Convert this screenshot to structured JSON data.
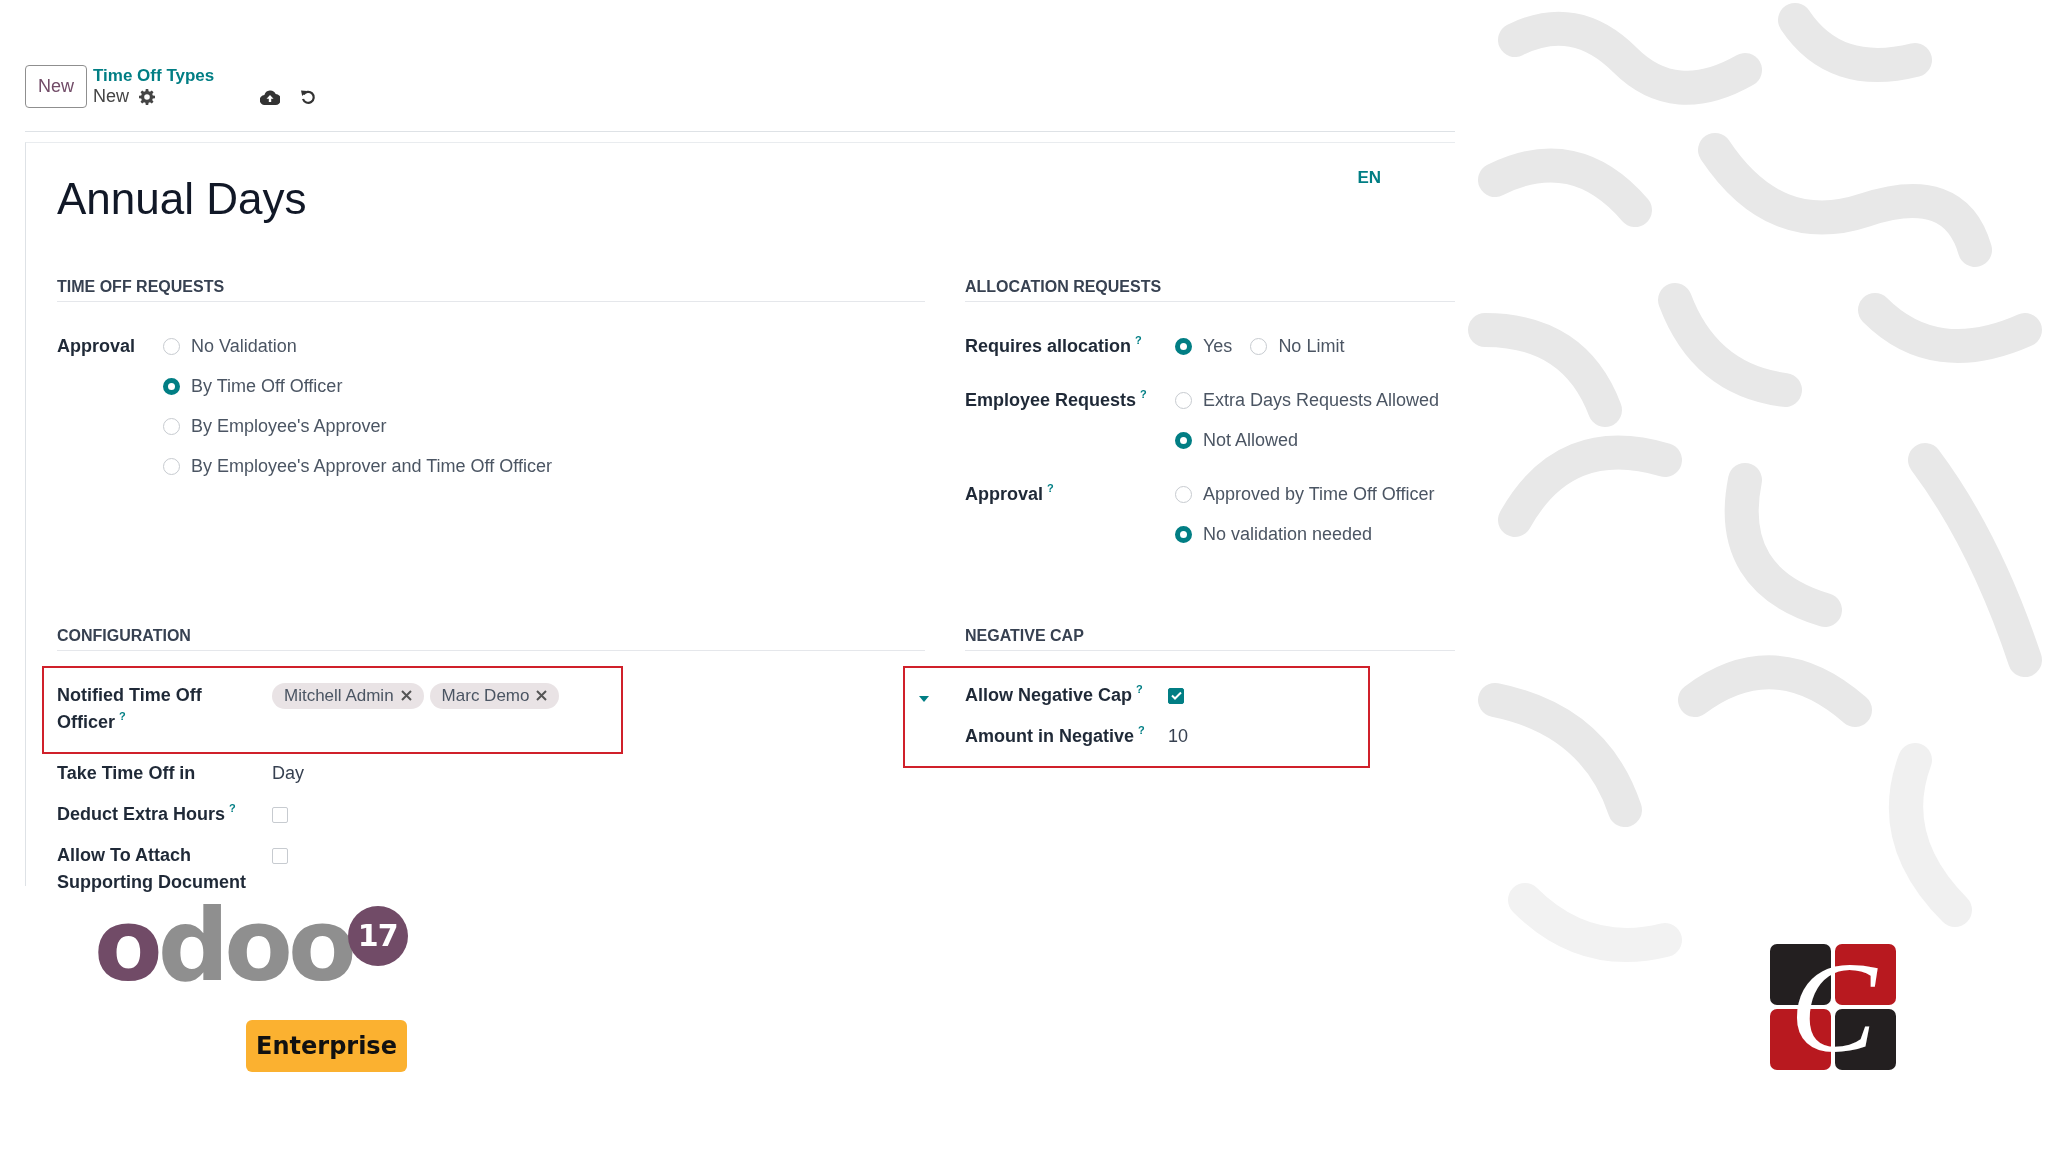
{
  "control_panel": {
    "new_button": "New",
    "breadcrumb": "Time Off Types",
    "record_name": "New"
  },
  "form": {
    "title": "Annual Days",
    "language": "EN",
    "sections": [
      {
        "heading": "TIME OFF REQUESTS",
        "groups": [
          {
            "highlighted": false,
            "fields": [
              {
                "kind": "radio",
                "label": "Approval",
                "options": [
                  {
                    "label": "No Validation",
                    "selected": false
                  },
                  {
                    "label": "By Time Off Officer",
                    "selected": true
                  },
                  {
                    "label": "By Employee's Approver",
                    "selected": false
                  },
                  {
                    "label": "By Employee's Approver and Time Off Officer",
                    "selected": false
                  }
                ]
              }
            ]
          }
        ]
      },
      {
        "heading": "ALLOCATION REQUESTS",
        "groups": [
          {
            "highlighted": false,
            "fields": [
              {
                "kind": "inline_radio",
                "label": "Requires allocation",
                "help": "?",
                "options": [
                  {
                    "label": "Yes",
                    "selected": true
                  },
                  {
                    "label": "No Limit",
                    "selected": false
                  }
                ]
              },
              {
                "kind": "radio",
                "label": "Employee Requests",
                "help": "?",
                "options": [
                  {
                    "label": "Extra Days Requests Allowed",
                    "selected": false
                  },
                  {
                    "label": "Not Allowed",
                    "selected": true
                  }
                ]
              },
              {
                "kind": "radio",
                "label": "Approval",
                "help": "?",
                "options": [
                  {
                    "label": "Approved by Time Off Officer",
                    "selected": false
                  },
                  {
                    "label": "No validation needed",
                    "selected": true
                  }
                ]
              }
            ]
          }
        ]
      },
      {
        "heading": "CONFIGURATION",
        "groups": [
          {
            "highlighted": true,
            "fields": [
              {
                "kind": "tags",
                "label": "Notified Time Off Officer",
                "help": "?",
                "tags": [
                  "Mitchell Admin",
                  "Marc Demo"
                ]
              }
            ]
          },
          {
            "highlighted": false,
            "fields": [
              {
                "kind": "text",
                "label": "Take Time Off in",
                "value": "Day"
              },
              {
                "kind": "checkbox",
                "label": "Deduct Extra Hours",
                "help": "?",
                "checked": false
              },
              {
                "kind": "checkbox",
                "label": "Allow To Attach Supporting Document",
                "checked": false
              }
            ]
          }
        ]
      },
      {
        "heading": "NEGATIVE CAP",
        "groups": [
          {
            "highlighted": true,
            "expanded": true,
            "fields": [
              {
                "kind": "checkbox",
                "label": "Allow Negative Cap",
                "help": "?",
                "checked": true
              },
              {
                "kind": "text",
                "label": "Amount in Negative",
                "help": "?",
                "value": "10"
              }
            ]
          }
        ]
      }
    ]
  },
  "branding": {
    "wordmark": "odoo",
    "version": "17",
    "edition": "Enterprise",
    "monogram": "C"
  }
}
